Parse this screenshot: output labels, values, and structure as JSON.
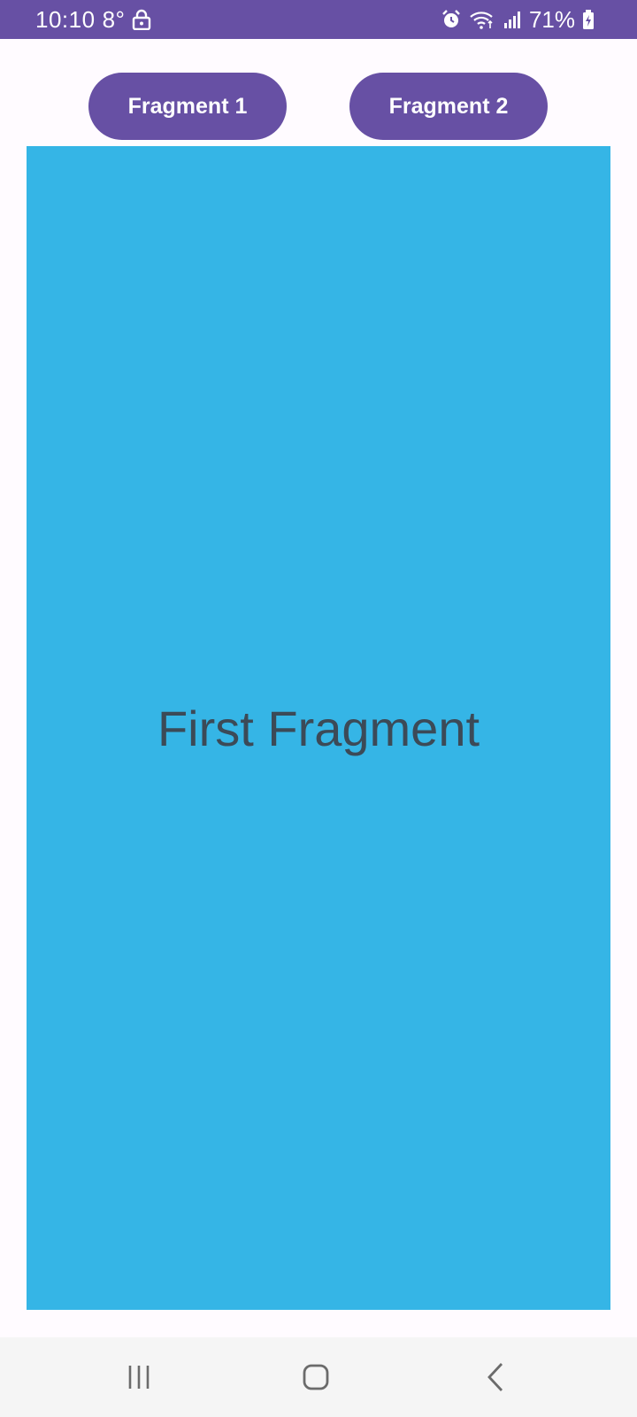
{
  "status_bar": {
    "time": "10:10",
    "temperature": "8°",
    "battery": "71%",
    "icons": [
      "lock-icon",
      "alarm-icon",
      "wifi-icon",
      "signal-icon",
      "battery-charging-icon"
    ],
    "background": "#6750a4"
  },
  "buttons": {
    "fragment1_label": "Fragment 1",
    "fragment2_label": "Fragment 2",
    "color": "#6750a4"
  },
  "fragment": {
    "text": "First Fragment",
    "background": "#35b5e6"
  },
  "navigation": {
    "icons": [
      "recent-apps-icon",
      "home-icon",
      "back-icon"
    ]
  }
}
